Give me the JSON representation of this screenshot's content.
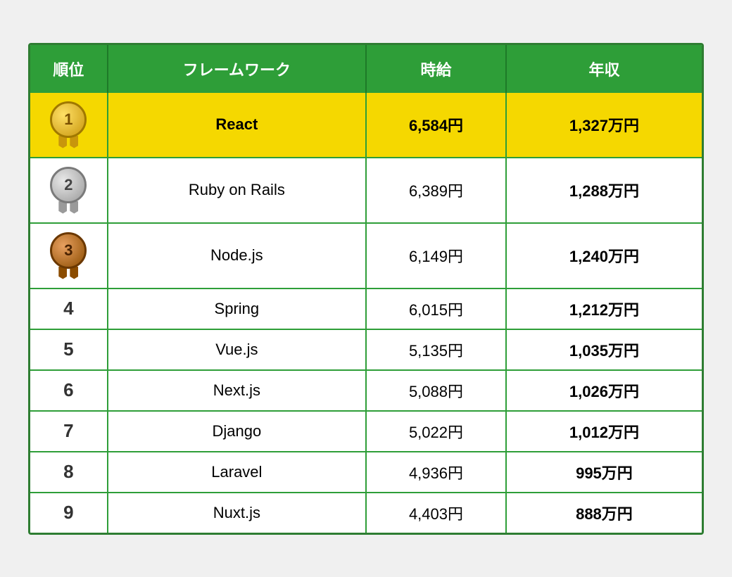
{
  "header": {
    "col1": "順位",
    "col2": "フレームワーク",
    "col3": "時給",
    "col4": "年収"
  },
  "rows": [
    {
      "rank": "1",
      "rankType": "gold",
      "framework": "React",
      "hourly": "6,584円",
      "annual": "1,327万円",
      "highlight": true
    },
    {
      "rank": "2",
      "rankType": "silver",
      "framework": "Ruby on Rails",
      "hourly": "6,389円",
      "annual": "1,288万円",
      "highlight": false
    },
    {
      "rank": "3",
      "rankType": "bronze",
      "framework": "Node.js",
      "hourly": "6,149円",
      "annual": "1,240万円",
      "highlight": false
    },
    {
      "rank": "4",
      "rankType": "number",
      "framework": "Spring",
      "hourly": "6,015円",
      "annual": "1,212万円",
      "highlight": false
    },
    {
      "rank": "5",
      "rankType": "number",
      "framework": "Vue.js",
      "hourly": "5,135円",
      "annual": "1,035万円",
      "highlight": false
    },
    {
      "rank": "6",
      "rankType": "number",
      "framework": "Next.js",
      "hourly": "5,088円",
      "annual": "1,026万円",
      "highlight": false
    },
    {
      "rank": "7",
      "rankType": "number",
      "framework": "Django",
      "hourly": "5,022円",
      "annual": "1,012万円",
      "highlight": false
    },
    {
      "rank": "8",
      "rankType": "number",
      "framework": "Laravel",
      "hourly": "4,936円",
      "annual": "995万円",
      "highlight": false
    },
    {
      "rank": "9",
      "rankType": "number",
      "framework": "Nuxt.js",
      "hourly": "4,403円",
      "annual": "888万円",
      "highlight": false
    }
  ]
}
